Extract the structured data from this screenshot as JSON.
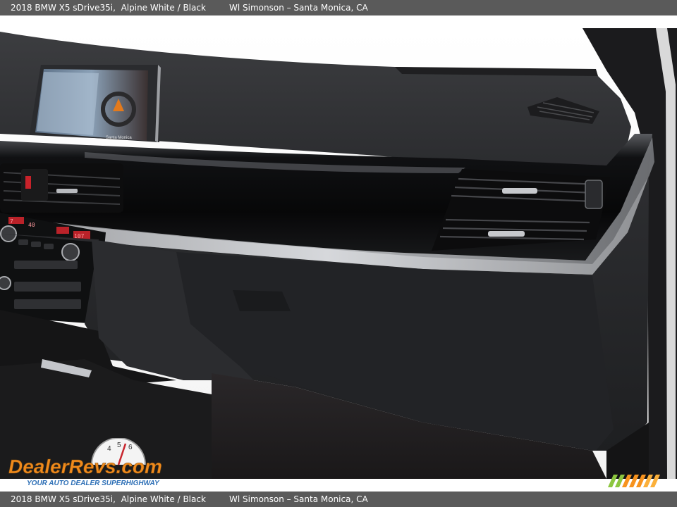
{
  "header": {
    "vehicle_title": "2018 BMW X5 sDrive35i,  Alpine White / Black",
    "dealer_location": "Wl Simonson – Santa Monica, CA"
  },
  "footer": {
    "vehicle_title": "2018 BMW X5 sDrive35i,  Alpine White / Black",
    "dealer_location": "Wl Simonson – Santa Monica, CA"
  },
  "photo": {
    "subject": "dashboard-passenger-side",
    "screen_caption": "Santa Monica",
    "radio_readouts": [
      "7",
      "107",
      "40"
    ]
  },
  "watermark": {
    "brand": "DealerRevs.com",
    "tagline": "YOUR AUTO DEALER SUPERHIGHWAY",
    "speedo_ticks": [
      "4",
      "5",
      "6"
    ]
  },
  "colors": {
    "bar_bg": "#5a5a5a",
    "dealer_orange": "#f08a1c",
    "dealer_blue": "#2d6fb6",
    "stripe_green": "#8cc63f",
    "stripe_orange": "#f7931e"
  }
}
